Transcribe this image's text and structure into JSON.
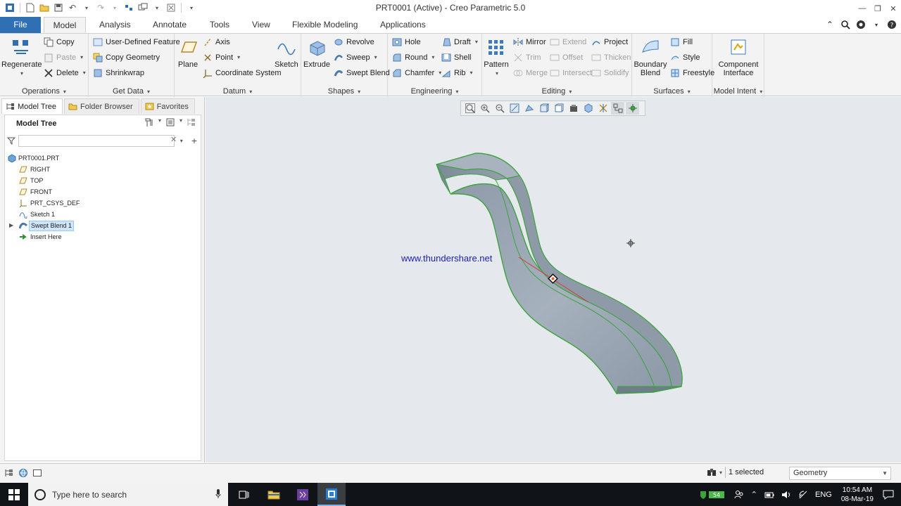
{
  "window": {
    "title": "PRT0001 (Active) - Creo Parametric 5.0"
  },
  "tabs": [
    {
      "label": "File"
    },
    {
      "label": "Model"
    },
    {
      "label": "Analysis"
    },
    {
      "label": "Annotate"
    },
    {
      "label": "Tools"
    },
    {
      "label": "View"
    },
    {
      "label": "Flexible Modeling"
    },
    {
      "label": "Applications"
    }
  ],
  "ribbon": {
    "operations": {
      "label": "Operations",
      "regenerate": "Regenerate",
      "copy": "Copy",
      "paste": "Paste",
      "delete": "Delete"
    },
    "get_data": {
      "label": "Get Data",
      "udf": "User-Defined Feature",
      "copy_geometry": "Copy Geometry",
      "shrinkwrap": "Shrinkwrap"
    },
    "datum": {
      "label": "Datum",
      "plane": "Plane",
      "axis": "Axis",
      "point": "Point",
      "csys": "Coordinate System",
      "sketch": "Sketch"
    },
    "shapes": {
      "label": "Shapes",
      "extrude": "Extrude",
      "revolve": "Revolve",
      "sweep": "Sweep",
      "swept_blend": "Swept Blend"
    },
    "engineering": {
      "label": "Engineering",
      "hole": "Hole",
      "round": "Round",
      "chamfer": "Chamfer",
      "draft": "Draft",
      "shell": "Shell",
      "rib": "Rib"
    },
    "editing": {
      "label": "Editing",
      "pattern": "Pattern",
      "mirror": "Mirror",
      "trim": "Trim",
      "merge": "Merge",
      "extend": "Extend",
      "offset": "Offset",
      "intersect": "Intersect",
      "project": "Project",
      "thicken": "Thicken",
      "solidify": "Solidify"
    },
    "surfaces": {
      "label": "Surfaces",
      "boundary_blend": "Boundary Blend",
      "fill": "Fill",
      "style": "Style",
      "freestyle": "Freestyle"
    },
    "model_intent": {
      "label": "Model Intent",
      "component_interface": "Component Interface"
    }
  },
  "left_panel": {
    "tabs": [
      {
        "label": "Model Tree"
      },
      {
        "label": "Folder Browser"
      },
      {
        "label": "Favorites"
      }
    ],
    "header": "Model Tree",
    "filter_placeholder": "",
    "tree": [
      {
        "label": "PRT0001.PRT",
        "icon": "part-icon"
      },
      {
        "label": "RIGHT",
        "icon": "datum-plane-icon"
      },
      {
        "label": "TOP",
        "icon": "datum-plane-icon"
      },
      {
        "label": "FRONT",
        "icon": "datum-plane-icon"
      },
      {
        "label": "PRT_CSYS_DEF",
        "icon": "csys-icon"
      },
      {
        "label": "Sketch 1",
        "icon": "sketch-icon"
      },
      {
        "label": "Swept Blend 1",
        "icon": "swept-blend-icon",
        "selected": true
      },
      {
        "label": "Insert Here",
        "icon": "insert-arrow-icon"
      }
    ]
  },
  "graphics": {
    "watermark": "www.thundershare.net"
  },
  "status": {
    "selected": "1 selected",
    "filter_value": "Geometry"
  },
  "taskbar": {
    "search_placeholder": "Type here to search",
    "language": "ENG",
    "time": "10:54 AM",
    "date": "08-Mar-19"
  },
  "colors": {
    "file_tab": "#2f6fb3",
    "ribbon_bg": "#f3f3f3",
    "graphics_bg": "#e5e9ed",
    "part_fill": "#9aa6b3",
    "edge_highlight": "#3da33d",
    "watermark": "#1d1db4",
    "taskbar": "#101317"
  }
}
